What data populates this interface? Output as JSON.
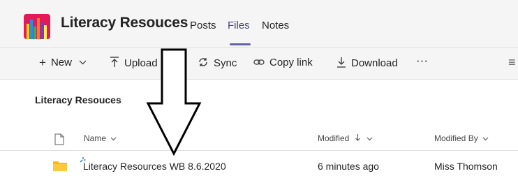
{
  "header": {
    "team_name": "Literacy Resouces",
    "tabs": [
      {
        "label": "Posts"
      },
      {
        "label": "Files"
      },
      {
        "label": "Notes"
      }
    ],
    "active_tab": "Files"
  },
  "toolbar": {
    "new_label": "New",
    "upload_label": "Upload",
    "sync_label": "Sync",
    "copy_link_label": "Copy link",
    "download_label": "Download",
    "more_label": "···",
    "view_icon": "≡"
  },
  "breadcrumb": {
    "current": "Literacy Resouces"
  },
  "table": {
    "columns": {
      "name": "Name",
      "modified": "Modified",
      "modified_by": "Modified By"
    },
    "rows": [
      {
        "name": "Literacy Resources WB 8.6.2020",
        "modified": "6 minutes ago",
        "modified_by": "Miss Thomson",
        "icon": "folder-icon"
      }
    ]
  },
  "colors": {
    "brand": "#6264a7",
    "folder": "#ffb900",
    "logo_bg": "#e3195a"
  }
}
